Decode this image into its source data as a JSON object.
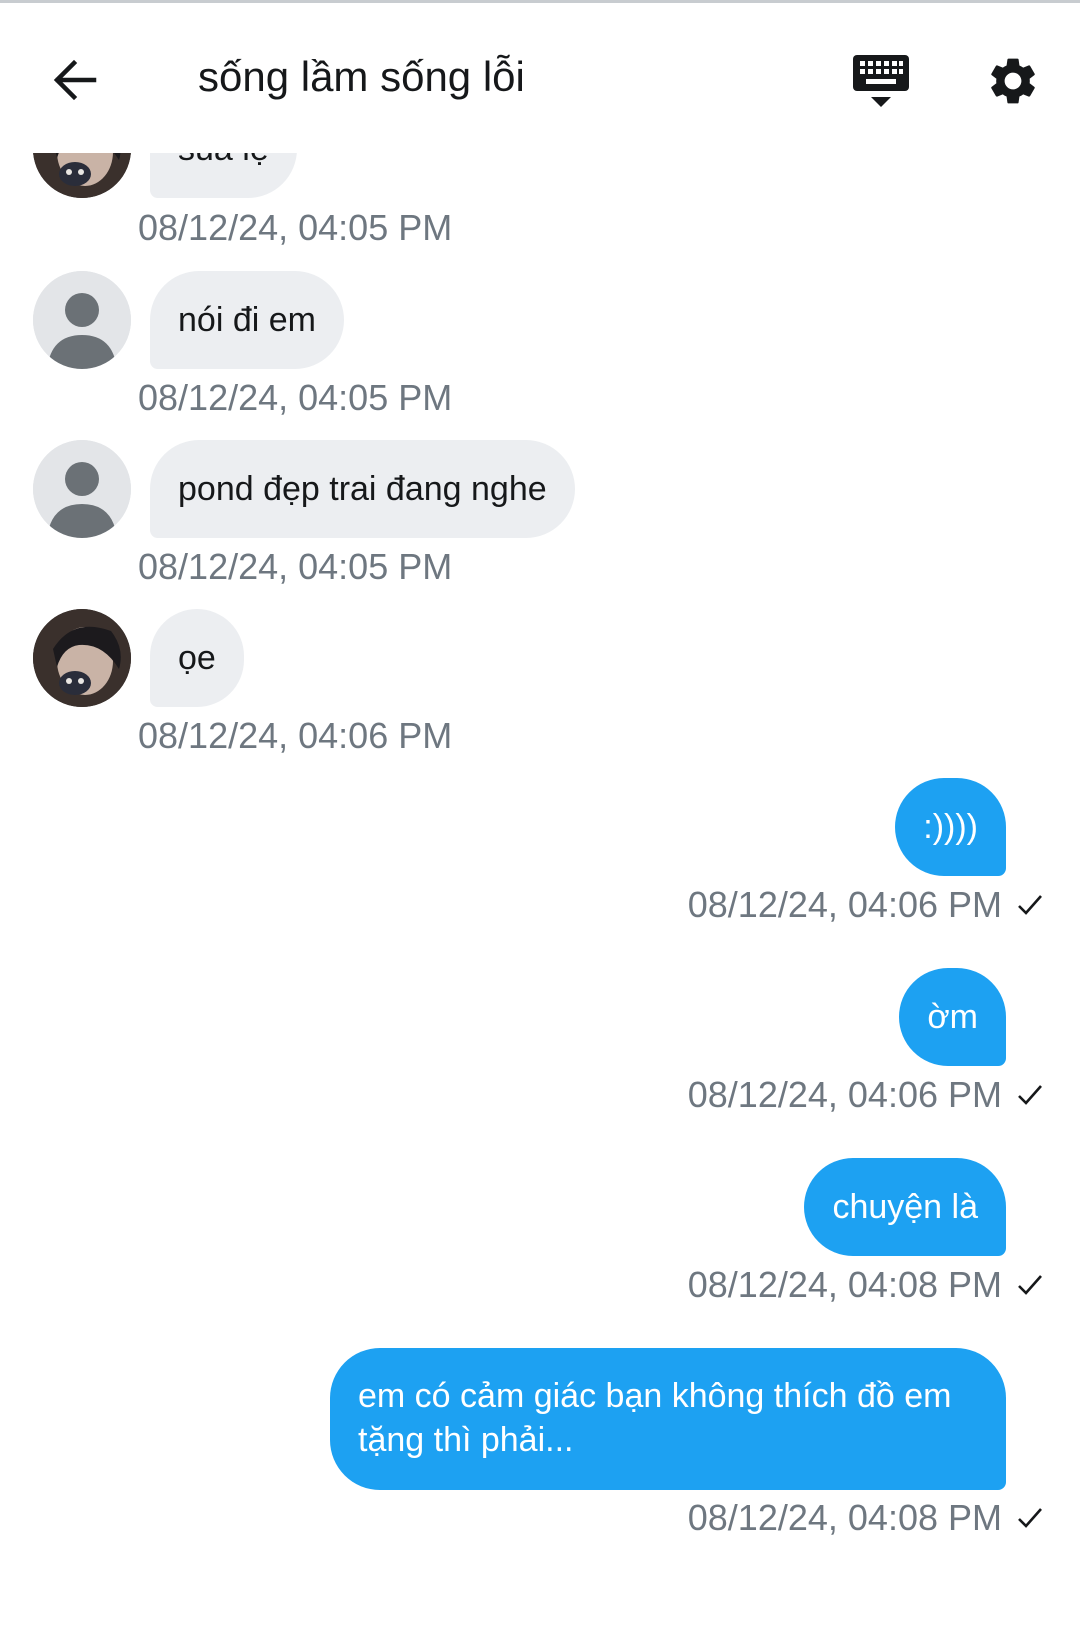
{
  "header": {
    "title": "sống lầm sống lỗi",
    "back_icon": "arrow-left-icon",
    "keyboard_icon": "keyboard-icon",
    "settings_icon": "gear-icon"
  },
  "messages": [
    {
      "direction": "in",
      "avatar": "photo",
      "text": "sủa lẹ",
      "time": "08/12/24, 04:05 PM"
    },
    {
      "direction": "in",
      "avatar": "default",
      "text": "nói đi em",
      "time": "08/12/24, 04:05 PM"
    },
    {
      "direction": "in",
      "avatar": "default",
      "text": "pond đẹp trai đang nghe",
      "time": "08/12/24, 04:05 PM"
    },
    {
      "direction": "in",
      "avatar": "photo",
      "text": "ọe",
      "time": "08/12/24, 04:06 PM"
    },
    {
      "direction": "out",
      "text": ":))))",
      "time": "08/12/24, 04:06 PM"
    },
    {
      "direction": "out",
      "text": "ờm",
      "time": "08/12/24, 04:06 PM"
    },
    {
      "direction": "out",
      "text": "chuyện là",
      "time": "08/12/24, 04:08 PM"
    },
    {
      "direction": "out",
      "text": "em có cảm giác bạn không thích đồ em tặng thì phải...",
      "time": "08/12/24, 04:08 PM"
    }
  ],
  "colors": {
    "outgoing_bubble": "#1da1f2",
    "incoming_bubble": "#eceef1",
    "timestamp": "#6e7780"
  }
}
